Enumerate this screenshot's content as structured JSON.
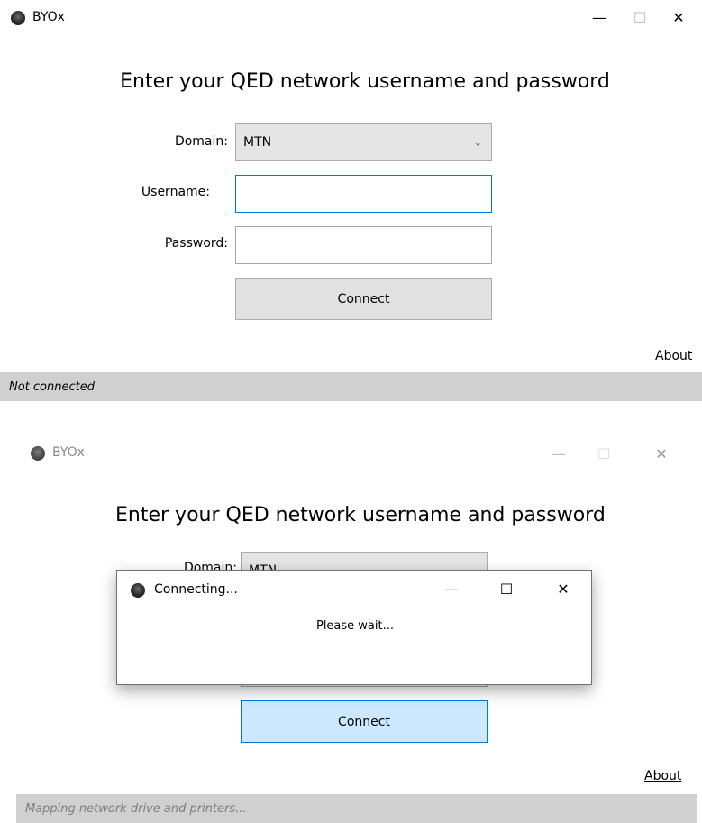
{
  "top": {
    "title": "BYOx",
    "heading": "Enter your QED network username and password",
    "domain_label": "Domain:",
    "domain_value": "MTN",
    "username_label": "Username:",
    "username_value": "",
    "password_label": "Password:",
    "password_value": "",
    "connect_label": "Connect",
    "about_label": "About",
    "status": "Not connected",
    "controls": {
      "minimize": "—",
      "maximize": "☐",
      "close": "✕"
    }
  },
  "bottom": {
    "title": "BYOx",
    "heading": "Enter your QED network username and password",
    "domain_label": "Domain:",
    "domain_value": "MTN",
    "connect_label": "Connect",
    "about_label": "About",
    "status": "Mapping network drive and printers...",
    "controls": {
      "minimize": "—",
      "maximize": "☐",
      "close": "✕"
    }
  },
  "dialog": {
    "title": "Connecting...",
    "message": "Please wait...",
    "controls": {
      "minimize": "—",
      "maximize": "☐",
      "close": "✕"
    }
  },
  "colors": {
    "status_bar": "#d0d0d0",
    "connect_active": "#cce8ff",
    "connect_active_border": "#0078d7",
    "focus_border": "#0078d7"
  },
  "icons": {
    "app": "byox-logo-icon",
    "chevron": "chevron-down-icon"
  }
}
